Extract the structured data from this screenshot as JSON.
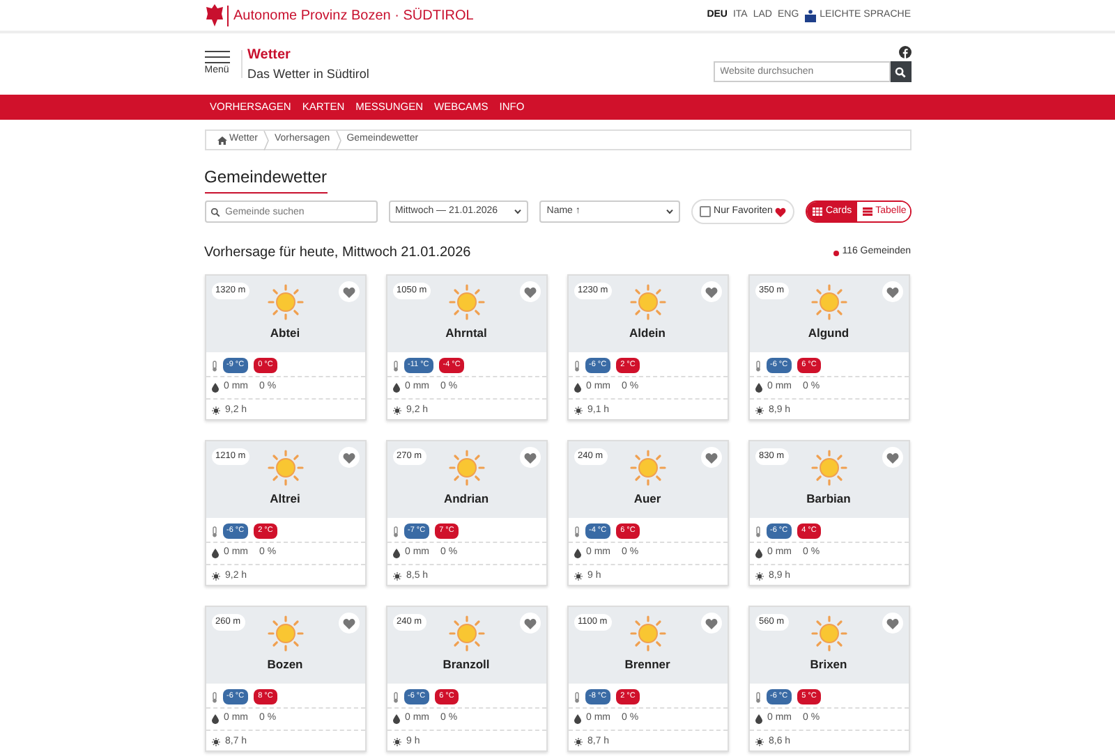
{
  "topbar": {
    "agency": "Autonome Provinz Bozen · SÜDTIROL",
    "languages": [
      {
        "label": "DEU",
        "selected": true
      },
      {
        "label": "ITA",
        "selected": false
      },
      {
        "label": "LAD",
        "selected": false
      },
      {
        "label": "ENG",
        "selected": false
      }
    ],
    "easy_language": "LEICHTE SPRACHE"
  },
  "header": {
    "menu": "Menü",
    "site_title": "Wetter",
    "site_subtitle": "Das Wetter in Südtirol",
    "search": {
      "placeholder": "Website durchsuchen"
    }
  },
  "nav": [
    "VORHERSAGEN",
    "KARTEN",
    "MESSUNGEN",
    "WEBCAMS",
    "INFO"
  ],
  "breadcrumb": [
    "Wetter",
    "Vorhersagen",
    "Gemeindewetter"
  ],
  "page_title": "Gemeindewetter",
  "filters": {
    "search": {
      "placeholder": "Gemeinde suchen"
    },
    "date": "Mittwoch — 21.01.2026",
    "sort": "Name ↑",
    "favorites": {
      "label": "Nur Favoriten",
      "checked": false
    },
    "views": [
      {
        "label": "Cards",
        "selected": true
      },
      {
        "label": "Tabelle",
        "selected": false
      }
    ]
  },
  "subtitle": "Vorhersage für heute, Mittwoch 21.01.2026",
  "count": "116 Gemeinden",
  "cards": [
    {
      "name": "Abtei",
      "altitude": "1320 m",
      "favorite": false,
      "min": "-9 °C",
      "max": "0 °C",
      "rain": "0 mm",
      "probability": "0 %",
      "sun": "9,2 h"
    },
    {
      "name": "Ahrntal",
      "altitude": "1050 m",
      "favorite": false,
      "min": "-11 °C",
      "max": "-4 °C",
      "rain": "0 mm",
      "probability": "0 %",
      "sun": "9,2 h"
    },
    {
      "name": "Aldein",
      "altitude": "1230 m",
      "favorite": false,
      "min": "-6 °C",
      "max": "2 °C",
      "rain": "0 mm",
      "probability": "0 %",
      "sun": "9,1 h"
    },
    {
      "name": "Algund",
      "altitude": "350 m",
      "favorite": false,
      "min": "-6 °C",
      "max": "6 °C",
      "rain": "0 mm",
      "probability": "0 %",
      "sun": "8,9 h"
    },
    {
      "name": "Altrei",
      "altitude": "1210 m",
      "favorite": false,
      "min": "-6 °C",
      "max": "2 °C",
      "rain": "0 mm",
      "probability": "0 %",
      "sun": "9,2 h"
    },
    {
      "name": "Andrian",
      "altitude": "270 m",
      "favorite": false,
      "min": "-7 °C",
      "max": "7 °C",
      "rain": "0 mm",
      "probability": "0 %",
      "sun": "8,5 h"
    },
    {
      "name": "Auer",
      "altitude": "240 m",
      "favorite": false,
      "min": "-4 °C",
      "max": "6 °C",
      "rain": "0 mm",
      "probability": "0 %",
      "sun": "9 h"
    },
    {
      "name": "Barbian",
      "altitude": "830 m",
      "favorite": false,
      "min": "-6 °C",
      "max": "4 °C",
      "rain": "0 mm",
      "probability": "0 %",
      "sun": "8,9 h"
    },
    {
      "name": "Bozen",
      "altitude": "260 m",
      "favorite": false,
      "min": "-6 °C",
      "max": "8 °C",
      "rain": "0 mm",
      "probability": "0 %",
      "sun": "8,7 h"
    },
    {
      "name": "Branzoll",
      "altitude": "240 m",
      "favorite": false,
      "min": "-6 °C",
      "max": "6 °C",
      "rain": "0 mm",
      "probability": "0 %",
      "sun": "9 h"
    },
    {
      "name": "Brenner",
      "altitude": "1100 m",
      "favorite": false,
      "min": "-8 °C",
      "max": "2 °C",
      "rain": "0 mm",
      "probability": "0 %",
      "sun": "8,7 h"
    },
    {
      "name": "Brixen",
      "altitude": "560 m",
      "favorite": false,
      "min": "-6 °C",
      "max": "5 °C",
      "rain": "0 mm",
      "probability": "0 %",
      "sun": "8,6 h"
    }
  ]
}
